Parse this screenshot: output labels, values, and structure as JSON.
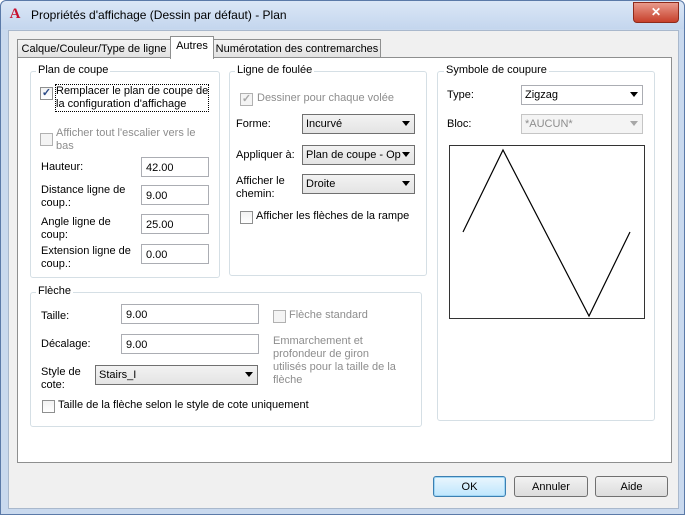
{
  "window": {
    "title": "Propriétés d'affichage (Dessin par défaut) - Plan",
    "app_icon": "A",
    "close_glyph": "✕"
  },
  "tabs": [
    {
      "label": "Calque/Couleur/Type de ligne",
      "active": false
    },
    {
      "label": "Autres",
      "active": true
    },
    {
      "label": "Numérotation des contremarches",
      "active": false
    }
  ],
  "plan_de_coupe": {
    "title": "Plan de coupe",
    "replace_checkbox": {
      "label_line1": "Remplacer le plan de coupe de",
      "label_line2": "la configuration d'affichage",
      "checked": true
    },
    "show_stair_checkbox": {
      "label_line1": "Afficher tout l'escalier vers le",
      "label_line2": "bas",
      "checked": false,
      "disabled": true
    },
    "fields": [
      {
        "label_line1": "Hauteur:",
        "label_line2": "",
        "value": "42.00"
      },
      {
        "label_line1": "Distance ligne de",
        "label_line2": "coup.:",
        "value": "9.00"
      },
      {
        "label_line1": "Angle ligne de",
        "label_line2": "coup:",
        "value": "25.00"
      },
      {
        "label_line1": "Extension ligne de",
        "label_line2": "coup.:",
        "value": "0.00"
      }
    ]
  },
  "ligne_de_foulee": {
    "title": "Ligne de foulée",
    "draw_each_checkbox": {
      "label": "Dessiner pour chaque volée",
      "checked": true,
      "disabled": true
    },
    "forme": {
      "label": "Forme:",
      "value": "Incurvé"
    },
    "appliquer": {
      "label": "Appliquer à:",
      "value": "Plan de coupe - Op"
    },
    "afficher_chemin": {
      "label_line1": "Afficher le",
      "label_line2": "chemin:",
      "value": "Droite"
    },
    "arrows_checkbox": {
      "label": "Afficher les flèches de la rampe",
      "checked": false
    }
  },
  "symbole_coupure": {
    "title": "Symbole de coupure",
    "type": {
      "label": "Type:",
      "value": "Zigzag"
    },
    "bloc": {
      "label": "Bloc:",
      "value": "*AUCUN*"
    }
  },
  "fleche": {
    "title": "Flèche",
    "taille": {
      "label": "Taille:",
      "value": "9.00"
    },
    "decalage": {
      "label": "Décalage:",
      "value": "9.00"
    },
    "style_cote": {
      "label_line1": "Style de",
      "label_line2": "cote:",
      "value": "Stairs_I"
    },
    "standard_checkbox": {
      "label": "Flèche standard",
      "checked": false,
      "disabled": true
    },
    "note": [
      "Emmarchement et",
      "profondeur de giron",
      "utilisés pour la taille de la",
      "flèche"
    ],
    "size_by_style_checkbox": {
      "label": "Taille de la flèche selon le style de cote uniquement",
      "checked": false
    }
  },
  "buttons": {
    "ok": "OK",
    "cancel": "Annuler",
    "help": "Aide"
  }
}
